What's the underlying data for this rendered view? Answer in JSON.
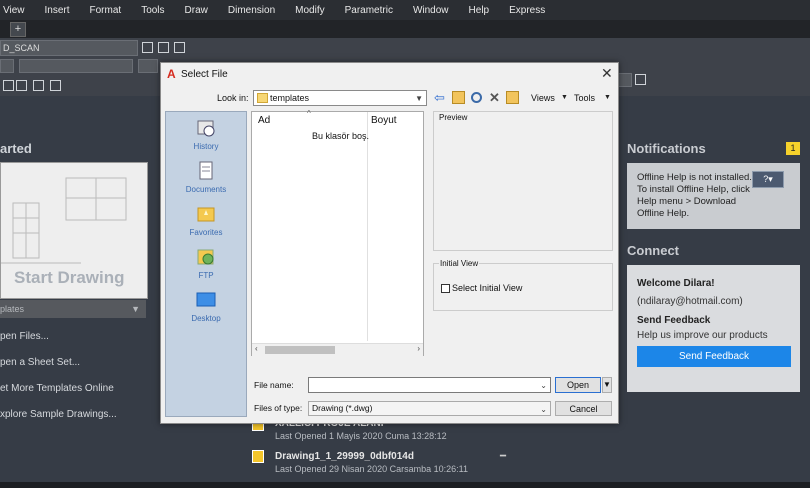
{
  "menu": [
    "View",
    "Insert",
    "Format",
    "Tools",
    "Draw",
    "Dimension",
    "Modify",
    "Parametric",
    "Window",
    "Help",
    "Express"
  ],
  "toolbar": {
    "layer_combo": "D_SCAN"
  },
  "start": {
    "title": "arted",
    "card_label": "Start Drawing",
    "templates_label": "plates",
    "links": [
      "pen Files...",
      "pen a Sheet Set...",
      "et More Templates Online",
      "xplore Sample Drawings..."
    ]
  },
  "notifications": {
    "title": "Notifications",
    "badge": "1",
    "text": "Offline Help is not installed. To install Offline Help, click Help menu > Download Offline Help."
  },
  "connect": {
    "title": "Connect",
    "welcome": "Welcome  Dilara!",
    "email": "(ndilaray@hotmail.com)",
    "feedback_title": "Send Feedback",
    "feedback_text": "Help us improve our products",
    "feedback_button": "Send Feedback"
  },
  "recent": [
    {
      "name": "XALLICI PROJE ALANI",
      "sub": "Last Opened 1 Mayis 2020 Cuma 13:28:12"
    },
    {
      "name": "Drawing1_1_29999_0dbf014d",
      "sub": "Last Opened 29 Nisan 2020 Carsamba 10:26:11"
    }
  ],
  "dialog": {
    "title": "Select File",
    "look_in_label": "Look in:",
    "look_in_value": "templates",
    "views_label": "Views",
    "tools_label": "Tools",
    "places": [
      "History",
      "Documents",
      "Favorites",
      "FTP",
      "Desktop"
    ],
    "columns": {
      "name": "Ad",
      "size": "Boyut"
    },
    "empty_message": "Bu klasör boş.",
    "preview_label": "Preview",
    "initial_view_label": "Initial View",
    "select_initial_view": "Select Initial View",
    "file_name_label": "File name:",
    "file_name_value": "",
    "file_type_label": "Files of type:",
    "file_type_value": "Drawing (*.dwg)",
    "open_button": "Open",
    "cancel_button": "Cancel"
  }
}
